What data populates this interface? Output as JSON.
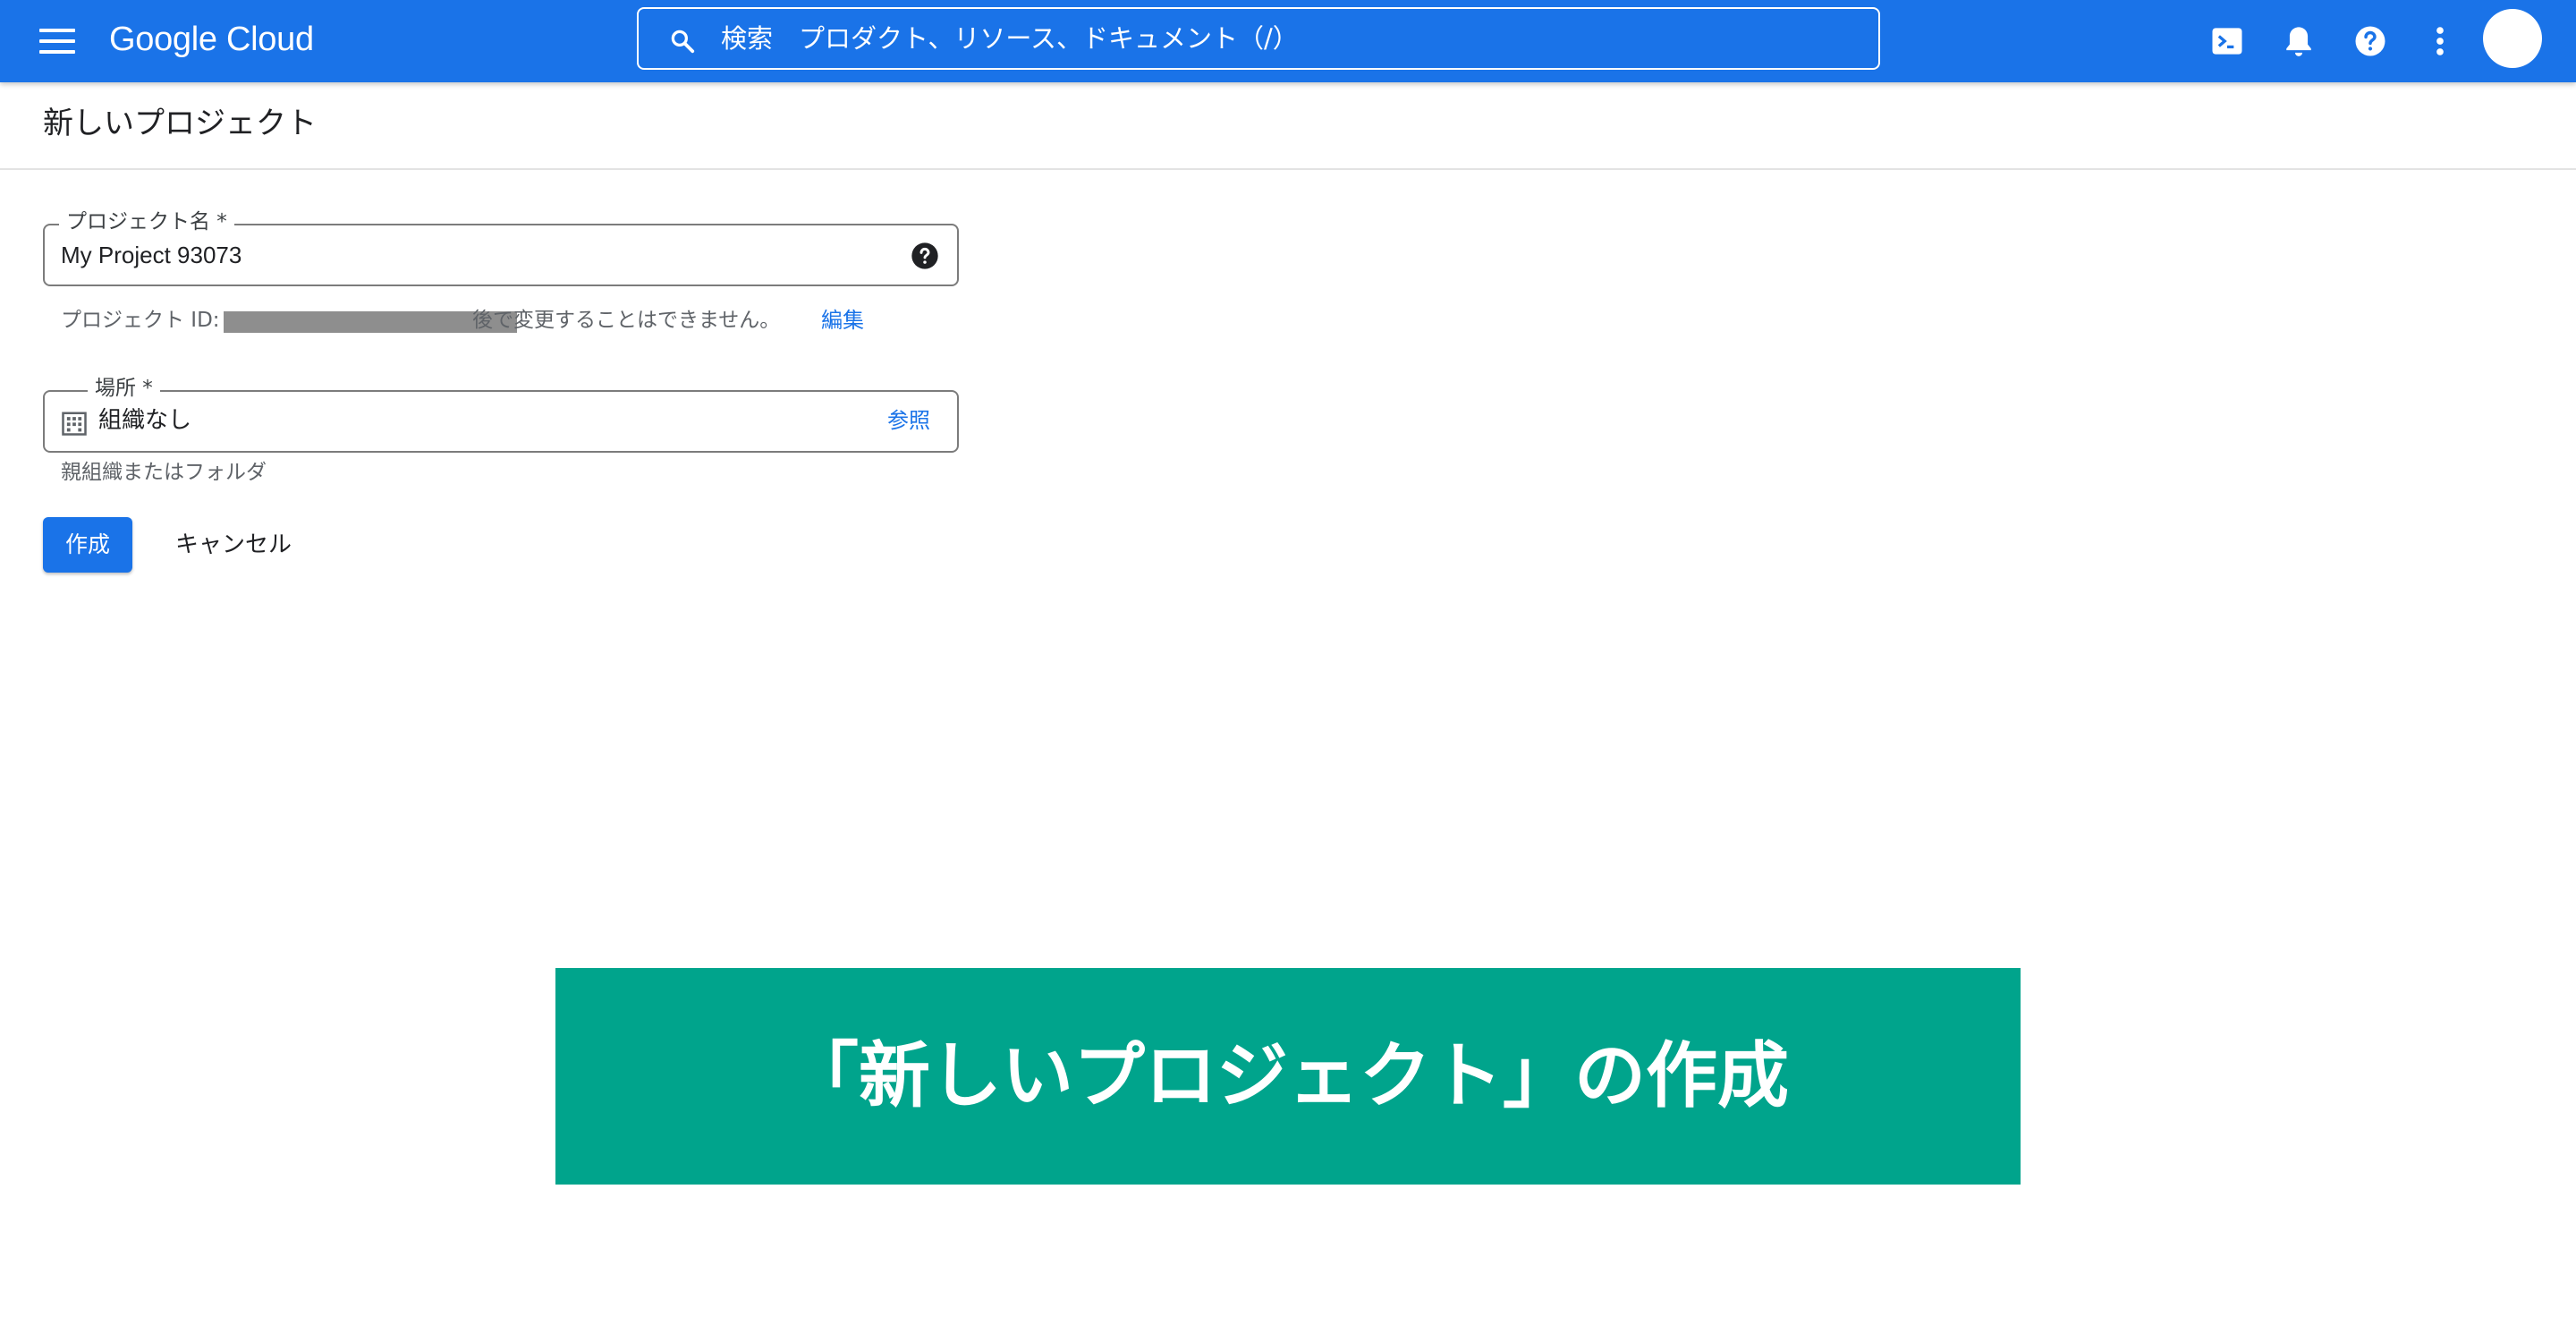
{
  "header": {
    "logo": "Google Cloud",
    "search_placeholder": "検索　プロダクト、リソース、ドキュメント（/）",
    "icons": [
      "menu-icon",
      "search-icon",
      "cloud-shell-icon",
      "bell-icon",
      "help-icon",
      "more-vert-icon"
    ]
  },
  "page": {
    "title": "新しいプロジェクト"
  },
  "form": {
    "project_name": {
      "label": "プロジェクト名 *",
      "value": "My Project 93073"
    },
    "project_id": {
      "label": "プロジェクト ID:",
      "note": "後で変更することはできません。",
      "edit_link": "編集"
    },
    "location": {
      "label": "場所 *",
      "value": "組織なし",
      "browse_link": "参照",
      "hint": "親組織またはフォルダ"
    },
    "buttons": {
      "create": "作成",
      "cancel": "キャンセル"
    }
  },
  "banner": {
    "text": "「新しいプロジェクト」の作成",
    "color": "#00a48c"
  },
  "colors": {
    "header": "#1a73e8",
    "link": "#1a73e8",
    "primary_button": "#1a73e8"
  }
}
